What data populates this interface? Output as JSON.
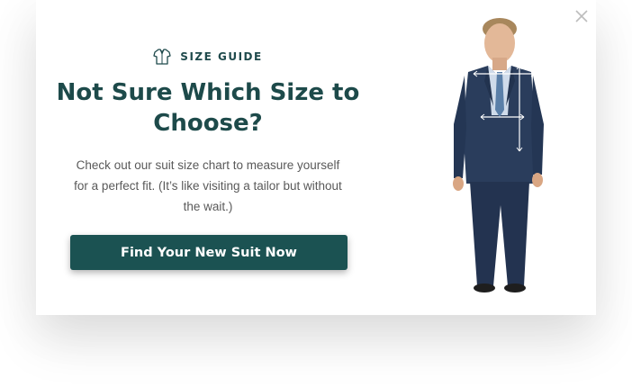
{
  "modal": {
    "eyebrow": "SIZE GUIDE",
    "headline": "Not Sure Which Size to Choose?",
    "description": "Check out our suit size chart to measure yourself for a perfect fit. (It’s like visiting a tailor but without the wait.)",
    "cta_label": "Find Your New Suit Now",
    "eyebrow_icon": "shirt-icon",
    "close_icon": "close-icon",
    "colors": {
      "brand": "#1b5252",
      "heading": "#1d4a4a",
      "body_text": "#595959",
      "suit": "#2a3d5c"
    }
  }
}
